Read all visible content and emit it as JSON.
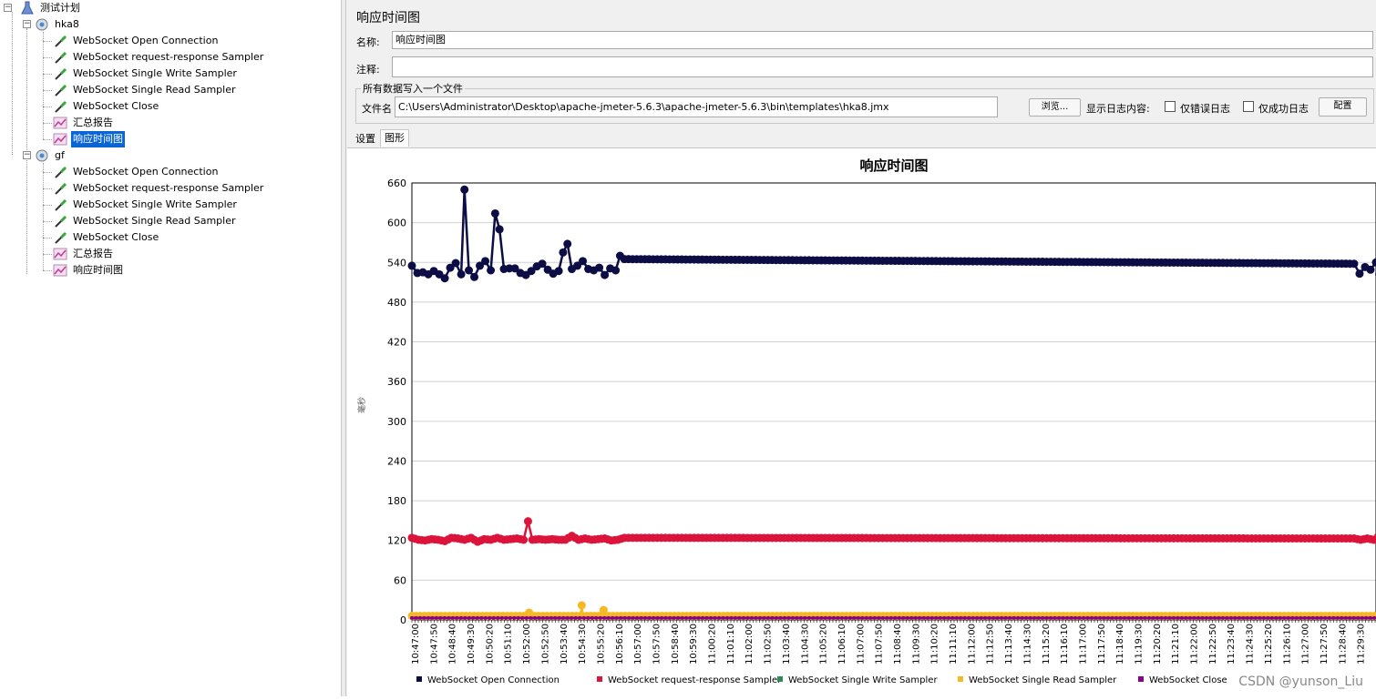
{
  "tree": {
    "root": "测试计划",
    "groups": [
      {
        "name": "hka8",
        "items": [
          {
            "label": "WebSocket Open Connection",
            "icon": "sampler-icon"
          },
          {
            "label": "WebSocket request-response Sampler",
            "icon": "sampler-icon"
          },
          {
            "label": "WebSocket Single Write Sampler",
            "icon": "sampler-icon"
          },
          {
            "label": "WebSocket Single Read Sampler",
            "icon": "sampler-icon"
          },
          {
            "label": "WebSocket Close",
            "icon": "sampler-icon"
          },
          {
            "label": "汇总报告",
            "icon": "listener-icon"
          },
          {
            "label": "响应时间图",
            "icon": "listener-icon",
            "selected": true
          }
        ]
      },
      {
        "name": "gf",
        "items": [
          {
            "label": "WebSocket Open Connection",
            "icon": "sampler-icon"
          },
          {
            "label": "WebSocket request-response Sampler",
            "icon": "sampler-icon"
          },
          {
            "label": "WebSocket Single Write Sampler",
            "icon": "sampler-icon"
          },
          {
            "label": "WebSocket Single Read Sampler",
            "icon": "sampler-icon"
          },
          {
            "label": "WebSocket Close",
            "icon": "sampler-icon"
          },
          {
            "label": "汇总报告",
            "icon": "listener-icon"
          },
          {
            "label": "响应时间图",
            "icon": "listener-icon"
          }
        ]
      }
    ]
  },
  "panel": {
    "title": "响应时间图",
    "name_label": "名称:",
    "name_value": "响应时间图",
    "comment_label": "注释:",
    "comment_value": "",
    "group_title": "所有数据写入一个文件",
    "file_label": "文件名",
    "file_value": "C:\\Users\\Administrator\\Desktop\\apache-jmeter-5.6.3\\apache-jmeter-5.6.3\\bin\\templates\\hka8.jmx",
    "browse_label": "浏览...",
    "log_label": "显示日志内容:",
    "errors_only_label": "仅错误日志",
    "success_only_label": "仅成功日志",
    "config_label": "配置",
    "tabs": [
      "设置",
      "图形"
    ],
    "active_tab": 1
  },
  "chart_data": {
    "type": "line",
    "title": "响应时间图",
    "ylabel": "毫秒",
    "xlabel": "",
    "ylim": [
      0,
      660
    ],
    "yticks": [
      0,
      60,
      120,
      180,
      240,
      300,
      360,
      420,
      480,
      540,
      600,
      660
    ],
    "xticks": [
      "10:47:00",
      "10:47:50",
      "10:48:40",
      "10:49:30",
      "10:50:20",
      "10:51:10",
      "10:52:00",
      "10:52:50",
      "10:53:40",
      "10:54:30",
      "10:55:20",
      "10:56:10",
      "10:57:00",
      "10:57:50",
      "10:58:40",
      "10:59:30",
      "11:00:20",
      "11:01:10",
      "11:02:00",
      "11:02:50",
      "11:03:40",
      "11:04:30",
      "11:05:20",
      "11:06:10",
      "11:07:00",
      "11:07:50",
      "11:08:40",
      "11:09:30",
      "11:10:20",
      "11:11:10",
      "11:12:00",
      "11:12:50",
      "11:13:40",
      "11:14:30",
      "11:15:20",
      "11:16:10",
      "11:17:00",
      "11:17:50",
      "11:18:40",
      "11:19:30",
      "11:20:20",
      "11:21:10",
      "11:22:00",
      "11:22:50",
      "11:23:40",
      "11:24:30",
      "11:25:20",
      "11:26:10",
      "11:27:00",
      "11:27:50",
      "11:28:40",
      "11:29:30"
    ],
    "x_minutes": [
      0,
      44
    ],
    "legend_position": "bottom",
    "grid": true,
    "series": [
      {
        "name": "WebSocket Open Connection",
        "color": "#0d0d45",
        "points": [
          [
            0,
            535
          ],
          [
            0.25,
            524
          ],
          [
            0.5,
            525
          ],
          [
            0.75,
            522
          ],
          [
            1,
            527
          ],
          [
            1.25,
            522
          ],
          [
            1.5,
            516
          ],
          [
            1.75,
            532
          ],
          [
            2,
            539
          ],
          [
            2.25,
            522
          ],
          [
            2.4,
            650
          ],
          [
            2.6,
            528
          ],
          [
            2.85,
            518
          ],
          [
            3.1,
            535
          ],
          [
            3.35,
            542
          ],
          [
            3.6,
            528
          ],
          [
            3.8,
            614
          ],
          [
            4,
            590
          ],
          [
            4.2,
            530
          ],
          [
            4.45,
            531
          ],
          [
            4.7,
            531
          ],
          [
            4.95,
            524
          ],
          [
            5.2,
            521
          ],
          [
            5.45,
            527
          ],
          [
            5.7,
            534
          ],
          [
            5.95,
            538
          ],
          [
            6.2,
            529
          ],
          [
            6.45,
            523
          ],
          [
            6.7,
            527
          ],
          [
            6.9,
            555
          ],
          [
            7.1,
            568
          ],
          [
            7.3,
            530
          ],
          [
            7.55,
            535
          ],
          [
            7.8,
            542
          ],
          [
            8.05,
            530
          ],
          [
            8.3,
            528
          ],
          [
            8.55,
            532
          ],
          [
            8.8,
            521
          ],
          [
            9.05,
            531
          ],
          [
            9.3,
            528
          ],
          [
            9.5,
            550
          ],
          [
            9.7,
            545
          ],
          [
            43,
            538
          ],
          [
            43.25,
            523
          ],
          [
            43.5,
            533
          ],
          [
            43.75,
            529
          ],
          [
            44,
            540
          ],
          [
            44.15,
            522
          ],
          [
            44.3,
            528
          ]
        ]
      },
      {
        "name": "WebSocket request-response Sampler",
        "color": "#dc143c",
        "points": [
          [
            0,
            124
          ],
          [
            0.3,
            121
          ],
          [
            0.6,
            120
          ],
          [
            0.9,
            122
          ],
          [
            1.2,
            121
          ],
          [
            1.5,
            119
          ],
          [
            1.8,
            124
          ],
          [
            2.1,
            123
          ],
          [
            2.4,
            121
          ],
          [
            2.7,
            124
          ],
          [
            3,
            118
          ],
          [
            3.3,
            122
          ],
          [
            3.6,
            121
          ],
          [
            3.9,
            124
          ],
          [
            4.2,
            121
          ],
          [
            4.5,
            122
          ],
          [
            4.8,
            123
          ],
          [
            5.1,
            121
          ],
          [
            5.3,
            149
          ],
          [
            5.5,
            121
          ],
          [
            5.8,
            122
          ],
          [
            6.1,
            121
          ],
          [
            6.4,
            122
          ],
          [
            6.7,
            121
          ],
          [
            7,
            121
          ],
          [
            7.3,
            127
          ],
          [
            7.6,
            121
          ],
          [
            7.9,
            123
          ],
          [
            8.2,
            121
          ],
          [
            8.5,
            122
          ],
          [
            8.8,
            123
          ],
          [
            9.1,
            120
          ],
          [
            9.4,
            121
          ],
          [
            9.7,
            124
          ],
          [
            43,
            123
          ],
          [
            43.3,
            121
          ],
          [
            43.6,
            123
          ],
          [
            43.9,
            121
          ],
          [
            44.1,
            126
          ],
          [
            44.3,
            122
          ]
        ]
      },
      {
        "name": "WebSocket Single Write Sampler",
        "color": "#2e8b57",
        "points": [
          [
            0,
            4
          ],
          [
            44.3,
            4
          ]
        ]
      },
      {
        "name": "WebSocket Single Read Sampler",
        "color": "#f5b921",
        "points": [
          [
            0,
            6
          ],
          [
            5.3,
            6
          ],
          [
            5.35,
            11
          ],
          [
            5.4,
            6
          ],
          [
            7.7,
            6
          ],
          [
            7.75,
            22
          ],
          [
            7.8,
            6
          ],
          [
            8.7,
            6
          ],
          [
            8.75,
            15
          ],
          [
            8.8,
            6
          ],
          [
            44.3,
            6
          ]
        ]
      },
      {
        "name": "WebSocket Close",
        "color": "#8b008b",
        "points": [
          [
            0,
            3
          ],
          [
            44.3,
            3
          ]
        ]
      }
    ]
  },
  "watermark": "CSDN @yunson_Liu"
}
